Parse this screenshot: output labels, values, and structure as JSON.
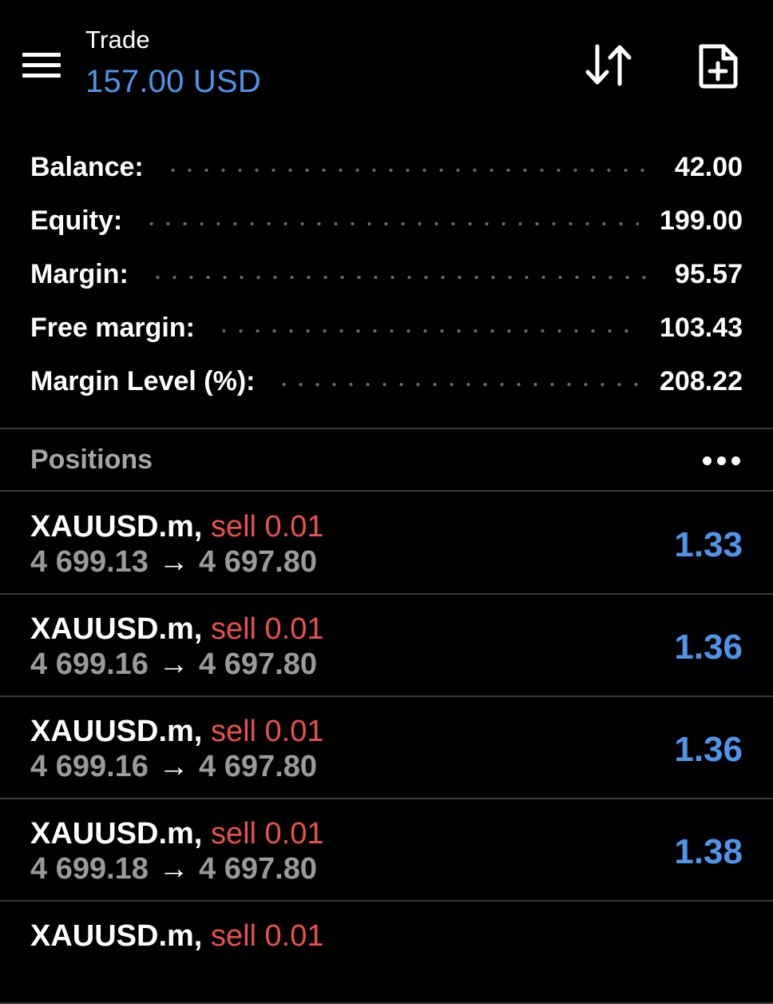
{
  "header": {
    "title": "Trade",
    "subtitle": "157.00 USD",
    "menu_icon": "hamburger-menu-icon",
    "sort_icon": "sort-arrows-icon",
    "new_order_icon": "new-document-plus-icon"
  },
  "account": {
    "rows": [
      {
        "label": "Balance:",
        "value": "42.00"
      },
      {
        "label": "Equity:",
        "value": "199.00"
      },
      {
        "label": "Margin:",
        "value": "95.57"
      },
      {
        "label": "Free margin:",
        "value": "103.43"
      },
      {
        "label": "Margin Level (%):",
        "value": "208.22"
      }
    ]
  },
  "positions": {
    "title": "Positions",
    "more_icon": "more-dots-icon",
    "items": [
      {
        "symbol": "XAUUSD.m,",
        "type": "sell 0.01",
        "open_price": "4 699.13",
        "arrow": "→",
        "current_price": "4 697.80",
        "profit": "1.33"
      },
      {
        "symbol": "XAUUSD.m,",
        "type": "sell 0.01",
        "open_price": "4 699.16",
        "arrow": "→",
        "current_price": "4 697.80",
        "profit": "1.36"
      },
      {
        "symbol": "XAUUSD.m,",
        "type": "sell 0.01",
        "open_price": "4 699.16",
        "arrow": "→",
        "current_price": "4 697.80",
        "profit": "1.36"
      },
      {
        "symbol": "XAUUSD.m,",
        "type": "sell 0.01",
        "open_price": "4 699.18",
        "arrow": "→",
        "current_price": "4 697.80",
        "profit": "1.38"
      },
      {
        "symbol": "XAUUSD.m,",
        "type": "sell 0.01",
        "open_price": "",
        "arrow": "",
        "current_price": "",
        "profit": ""
      }
    ]
  },
  "colors": {
    "background": "#000000",
    "accent_blue": "#4e95ea",
    "sell_red": "#e8514f",
    "muted_gray": "#9a9a9a",
    "divider": "#3a3a3a"
  }
}
